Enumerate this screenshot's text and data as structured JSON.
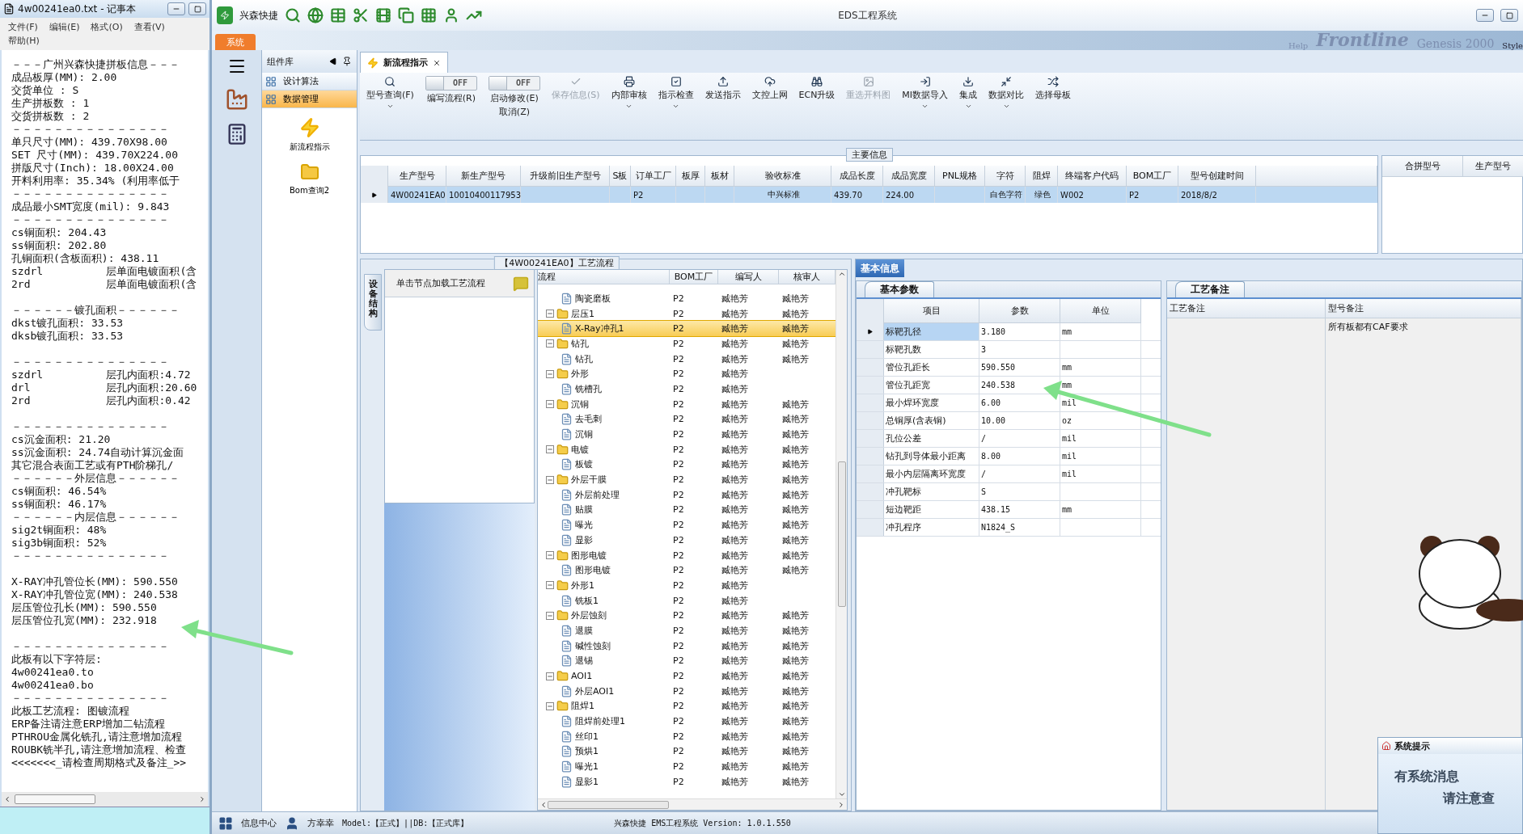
{
  "notepad": {
    "title": "4w00241ea0.txt - 记事本",
    "menu": [
      "文件(F)",
      "编辑(E)",
      "格式(O)",
      "查看(V)",
      "帮助(H)"
    ],
    "sections": [
      {
        "lines": [
          "－－－广州兴森快捷拼板信息－－－",
          "成品板厚(MM): 2.00",
          "交货单位 : S",
          "生产拼板数 : 1",
          "交货拼板数 : 2",
          "－－－－－－－－－－－－－－－",
          "单只尺寸(MM): 439.70X98.00",
          "SET 尺寸(MM): 439.70X224.00",
          "拼版尺寸(Inch): 18.00X24.00",
          "开料利用率: 35.34% (利用率低于",
          "－－－－－－－－－－－－－－－",
          "成品最小SMT宽度(mil): 9.843",
          "－－－－－－－－－－－－－－－",
          "cs铜面积: 204.43",
          "ss铜面积: 202.80",
          "孔铜面积(含板面积): 438.11",
          "szdrl          层单面电镀面积(含",
          "2rd            层单面电镀面积(含"
        ]
      },
      {
        "lines": [
          "－－－－－－镀孔面积－－－－－－",
          "dkst镀孔面积: 33.53",
          "dksb镀孔面积: 33.53"
        ]
      },
      {
        "lines": [
          "－－－－－－－－－－－－－－－",
          "szdrl          层孔内面积:4.72",
          "drl            层孔内面积:20.60",
          "2rd            层孔内面积:0.42"
        ]
      },
      {
        "lines": [
          "－－－－－－－－－－－－－－－",
          "cs沉金面积: 21.20",
          "ss沉金面积: 24.74自动计算沉金面",
          "其它混合表面工艺或有PTH阶梯孔/",
          "－－－－－－外层信息－－－－－－",
          "cs铜面积: 46.54%",
          "ss铜面积: 46.17%",
          "－－－－－－内层信息－－－－－－",
          "sig2t铜面积: 48%",
          "sig3b铜面积: 52%",
          "－－－－－－－－－－－－－－－"
        ]
      },
      {
        "lines": [
          "X-RAY冲孔管位长(MM): 590.550",
          "X-RAY冲孔管位宽(MM): 240.538",
          "层压管位孔长(MM): 590.550",
          "层压管位孔宽(MM): 232.918"
        ]
      },
      {
        "lines": [
          "－－－－－－－－－－－－－－－",
          "此板有以下字符层:",
          "4w00241ea0.to",
          "4w00241ea0.bo",
          "－－－－－－－－－－－－－－－",
          "此板工艺流程: 图镀流程",
          "ERP备注请注意ERP增加二钻流程",
          "PTHROU金属化铣孔,请注意增加流程",
          "ROUBK铣半孔,请注意增加流程、检查",
          "<<<<<<<_请检查周期格式及备注_>>"
        ]
      }
    ]
  },
  "app": {
    "quick_title": "兴森快捷",
    "title": "EDS工程系统",
    "ribbon_tab": "系统",
    "ribbon_bg": [
      "Help",
      "Frontline",
      "Genesis 2000",
      "Style"
    ],
    "component_panel": {
      "title": "组件库",
      "items": [
        {
          "label": "设计算法",
          "selected": false
        },
        {
          "label": "数据管理",
          "selected": true
        }
      ],
      "tools": [
        "新流程指示",
        "Bom查询2"
      ]
    },
    "doc_tab": {
      "label": "新流程指示"
    },
    "toolbar": [
      {
        "kind": "button",
        "label": "型号查询(F)",
        "dropdown": true,
        "disabled": false
      },
      {
        "kind": "toggle",
        "label": "编写流程(R)",
        "switch_text": "OFF",
        "on": false
      },
      {
        "kind": "toggle",
        "label": "启动修改(E)",
        "sublabel": "取消(Z)",
        "switch_text": "OFF",
        "on": false
      },
      {
        "kind": "button",
        "label": "保存信息(S)",
        "dropdown": false,
        "disabled": true
      },
      {
        "kind": "button",
        "label": "内部审核",
        "dropdown": true,
        "disabled": false
      },
      {
        "kind": "button",
        "label": "指示检查",
        "dropdown": true,
        "disabled": false
      },
      {
        "kind": "button",
        "label": "发送指示",
        "dropdown": false,
        "disabled": false
      },
      {
        "kind": "button",
        "label": "文控上网",
        "dropdown": false,
        "disabled": false
      },
      {
        "kind": "button",
        "label": "ECN升级",
        "dropdown": false,
        "disabled": false
      },
      {
        "kind": "button",
        "label": "重选开料图",
        "dropdown": false,
        "disabled": true
      },
      {
        "kind": "button",
        "label": "MI数据导入",
        "dropdown": true,
        "disabled": false
      },
      {
        "kind": "button",
        "label": "集成",
        "dropdown": true,
        "disabled": false
      },
      {
        "kind": "button",
        "label": "数据对比",
        "dropdown": true,
        "disabled": false
      },
      {
        "kind": "button",
        "label": "选择母板",
        "dropdown": false,
        "disabled": false
      }
    ],
    "main_info": {
      "title": "主要信息",
      "columns": [
        "生产型号",
        "新生产型号",
        "升级前旧生产型号",
        "S板",
        "订单工厂",
        "板厚",
        "板材",
        "验收标准",
        "成品长度",
        "成品宽度",
        "PNL规格",
        "字符",
        "阻焊",
        "终端客户代码",
        "BOM工厂",
        "型号创建时间"
      ],
      "rows": [
        {
          "selected": true,
          "cells": [
            "4W00241EA0",
            "10010400117953",
            null,
            null,
            "P2",
            null,
            null,
            "中兴标准",
            "439.70",
            "224.00",
            null,
            "白色字符",
            "绿色",
            "W002",
            "P2",
            "2018/8/2"
          ]
        }
      ],
      "side_columns": [
        "合拼型号",
        "生产型号"
      ]
    },
    "process": {
      "title": "【4W00241EA0】工艺流程",
      "side_tab": "设备结构",
      "hint": "单击节点加载工艺流程",
      "columns": [
        "流程",
        "BOM工厂",
        "编写人",
        "核审人"
      ],
      "tree": [
        {
          "children": [
            {
              "label": "陶瓷磨板",
              "bom": "P2",
              "writer": "臧艳芳",
              "reviewer": "臧艳芳",
              "selected": false
            }
          ]
        },
        {
          "label": "层压1",
          "bom": "P2",
          "writer": "臧艳芳",
          "reviewer": "臧艳芳",
          "selected": false,
          "children": [
            {
              "label": "X-Ray冲孔1",
              "bom": "P2",
              "writer": "臧艳芳",
              "reviewer": "臧艳芳",
              "selected": true
            }
          ]
        },
        {
          "label": "钻孔",
          "bom": "P2",
          "writer": "臧艳芳",
          "reviewer": "臧艳芳",
          "selected": false,
          "children": [
            {
              "label": "钻孔",
              "bom": "P2",
              "writer": "臧艳芳",
              "reviewer": "臧艳芳",
              "selected": false
            }
          ]
        },
        {
          "label": "外形",
          "bom": "P2",
          "writer": "臧艳芳",
          "selected": false,
          "children": [
            {
              "label": "铣槽孔",
              "bom": "P2",
              "writer": "臧艳芳",
              "selected": false
            }
          ]
        },
        {
          "label": "沉铜",
          "bom": "P2",
          "writer": "臧艳芳",
          "reviewer": "臧艳芳",
          "selected": false,
          "children": [
            {
              "label": "去毛刺",
              "bom": "P2",
              "writer": "臧艳芳",
              "reviewer": "臧艳芳",
              "selected": false
            },
            {
              "label": "沉铜",
              "bom": "P2",
              "writer": "臧艳芳",
              "reviewer": "臧艳芳",
              "selected": false
            }
          ]
        },
        {
          "label": "电镀",
          "bom": "P2",
          "writer": "臧艳芳",
          "reviewer": "臧艳芳",
          "selected": false,
          "children": [
            {
              "label": "板镀",
              "bom": "P2",
              "writer": "臧艳芳",
              "reviewer": "臧艳芳",
              "selected": false
            }
          ]
        },
        {
          "label": "外层干膜",
          "bom": "P2",
          "writer": "臧艳芳",
          "reviewer": "臧艳芳",
          "selected": false,
          "children": [
            {
              "label": "外层前处理",
              "bom": "P2",
              "writer": "臧艳芳",
              "reviewer": "臧艳芳",
              "selected": false
            },
            {
              "label": "贴膜",
              "bom": "P2",
              "writer": "臧艳芳",
              "reviewer": "臧艳芳",
              "selected": false
            },
            {
              "label": "曝光",
              "bom": "P2",
              "writer": "臧艳芳",
              "reviewer": "臧艳芳",
              "selected": false
            },
            {
              "label": "显影",
              "bom": "P2",
              "writer": "臧艳芳",
              "reviewer": "臧艳芳",
              "selected": false
            }
          ]
        },
        {
          "label": "图形电镀",
          "bom": "P2",
          "writer": "臧艳芳",
          "reviewer": "臧艳芳",
          "selected": false,
          "children": [
            {
              "label": "图形电镀",
              "bom": "P2",
              "writer": "臧艳芳",
              "reviewer": "臧艳芳",
              "selected": false
            }
          ]
        },
        {
          "label": "外形1",
          "bom": "P2",
          "writer": "臧艳芳",
          "selected": false,
          "children": [
            {
              "label": "铣板1",
              "bom": "P2",
              "writer": "臧艳芳",
              "selected": false
            }
          ]
        },
        {
          "label": "外层蚀刻",
          "bom": "P2",
          "writer": "臧艳芳",
          "reviewer": "臧艳芳",
          "selected": false,
          "children": [
            {
              "label": "退膜",
              "bom": "P2",
              "writer": "臧艳芳",
              "reviewer": "臧艳芳",
              "selected": false
            },
            {
              "label": "碱性蚀刻",
              "bom": "P2",
              "writer": "臧艳芳",
              "reviewer": "臧艳芳",
              "selected": false
            },
            {
              "label": "退锡",
              "bom": "P2",
              "writer": "臧艳芳",
              "reviewer": "臧艳芳",
              "selected": false
            }
          ]
        },
        {
          "label": "AOI1",
          "bom": "P2",
          "writer": "臧艳芳",
          "reviewer": "臧艳芳",
          "selected": false,
          "children": [
            {
              "label": "外层AOI1",
              "bom": "P2",
              "writer": "臧艳芳",
              "reviewer": "臧艳芳",
              "selected": false
            }
          ]
        },
        {
          "label": "阻焊1",
          "bom": "P2",
          "writer": "臧艳芳",
          "reviewer": "臧艳芳",
          "selected": false,
          "children": [
            {
              "label": "阻焊前处理1",
              "bom": "P2",
              "writer": "臧艳芳",
              "reviewer": "臧艳芳",
              "selected": false
            },
            {
              "label": "丝印1",
              "bom": "P2",
              "writer": "臧艳芳",
              "reviewer": "臧艳芳",
              "selected": false
            },
            {
              "label": "预烘1",
              "bom": "P2",
              "writer": "臧艳芳",
              "reviewer": "臧艳芳",
              "selected": false
            },
            {
              "label": "曝光1",
              "bom": "P2",
              "writer": "臧艳芳",
              "reviewer": "臧艳芳",
              "selected": false
            },
            {
              "label": "显影1",
              "bom": "P2",
              "writer": "臧艳芳",
              "reviewer": "臧艳芳",
              "selected": false
            }
          ]
        }
      ]
    },
    "basic_info": {
      "tab": "基本信息",
      "params_tab": "基本参数",
      "columns": [
        "项目",
        "参数",
        "单位"
      ],
      "rows": [
        {
          "item": "标靶孔径",
          "value": "3.180",
          "unit": "mm",
          "selected": true
        },
        {
          "item": "标靶孔数",
          "value": "3",
          "selected": false
        },
        {
          "item": "管位孔距长",
          "value": "590.550",
          "unit": "mm",
          "selected": false
        },
        {
          "item": "管位孔距宽",
          "value": "240.538",
          "unit": "mm",
          "selected": false
        },
        {
          "item": "最小焊环宽度",
          "value": "6.00",
          "unit": "mil",
          "selected": false
        },
        {
          "item": "总铜厚(含表铜)",
          "value": "10.00",
          "unit": "oz",
          "selected": false
        },
        {
          "item": "孔位公差",
          "value": "/",
          "unit": "mil",
          "selected": false
        },
        {
          "item": "钻孔到导体最小距离",
          "value": "8.00",
          "unit": "mil",
          "selected": false
        },
        {
          "item": "最小内层隔离环宽度",
          "value": "/",
          "unit": "mil",
          "selected": false
        },
        {
          "item": "冲孔靶标",
          "value": "S",
          "selected": false
        },
        {
          "item": "短边靶距",
          "value": "438.15",
          "unit": "mm",
          "selected": false
        },
        {
          "item": "冲孔程序",
          "value": "N1824_S",
          "selected": false
        }
      ],
      "notes_tab": "工艺备注",
      "notes_columns": [
        "工艺备注",
        "型号备注"
      ],
      "model_note": "所有板都有CAF要求"
    },
    "popup": {
      "title": "系统提示",
      "line1": "有系统消息",
      "line2": "请注意查"
    },
    "status": {
      "info": "信息中心",
      "user": "方幸幸",
      "model": "Model:【正式】||DB:【正式库】",
      "version": "兴森快捷 EMS工程系统 Version: 1.0.1.550"
    }
  }
}
